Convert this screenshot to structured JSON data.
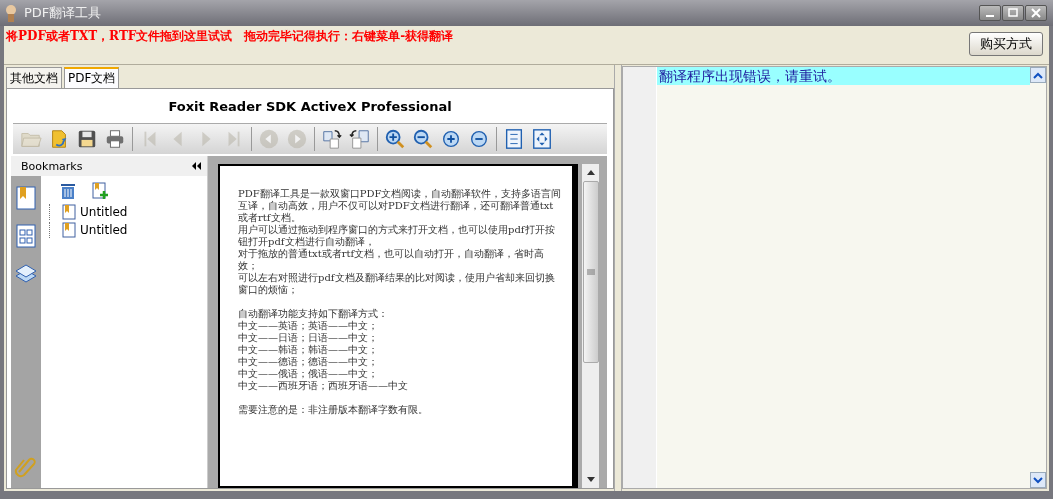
{
  "window": {
    "title": "PDF翻译工具"
  },
  "notice": "将PDF或者TXT，RTF文件拖到这里试试　拖动完毕记得执行：右键菜单-获得翻译",
  "buy_button": "购买方式",
  "tabs": [
    {
      "label": "其他文档",
      "selected": false
    },
    {
      "label": "PDF文档",
      "selected": true
    }
  ],
  "viewer": {
    "title": "Foxit Reader SDK ActiveX Professional",
    "toolbar": [
      [
        {
          "kind": "open-folder",
          "disabled": true
        },
        {
          "kind": "open-file",
          "disabled": false
        },
        {
          "kind": "save",
          "disabled": false
        },
        {
          "kind": "print",
          "disabled": false
        }
      ],
      [
        {
          "kind": "first",
          "disabled": true
        },
        {
          "kind": "prev",
          "disabled": true
        },
        {
          "kind": "next",
          "disabled": true
        },
        {
          "kind": "last",
          "disabled": true
        }
      ],
      [
        {
          "kind": "back",
          "disabled": true
        },
        {
          "kind": "forward",
          "disabled": true
        }
      ],
      [
        {
          "kind": "rotate-right",
          "disabled": false
        },
        {
          "kind": "rotate-left",
          "disabled": false
        }
      ],
      [
        {
          "kind": "zoom-in",
          "disabled": false
        },
        {
          "kind": "zoom-out",
          "disabled": false
        },
        {
          "kind": "plus",
          "disabled": false
        },
        {
          "kind": "minus",
          "disabled": false
        }
      ],
      [
        {
          "kind": "actual-size",
          "disabled": false
        },
        {
          "kind": "fit-page",
          "disabled": false
        }
      ]
    ],
    "bookmarks_header": "Bookmarks",
    "bookmarks": [
      "Untitled",
      "Untitled"
    ],
    "page_paragraphs": [
      [
        "PDF翻译工具是一款双窗口PDF文档阅读，自动翻译软件，支持多语言间互译，自动高效，用户不仅可以对PDF文档进行翻译，还可翻译普通txt或者rtf文档。",
        "用户可以通过拖动到程序窗口的方式来打开文档，也可以使用pdf打开按钮打开pdf文档进行自动翻译，",
        "对于拖放的普通txt或者rtf文档，也可以自动打开，自动翻译，省时高效；",
        "可以左右对照进行pdf文档及翻译结果的比对阅读，使用户省却来回切换窗口的烦恼；"
      ],
      [
        "自动翻译功能支持如下翻译方式：",
        "中文——英语；英语——中文；",
        "中文——日语；日语——中文；",
        "中文——韩语；韩语——中文；",
        "中文——德语；德语——中文；",
        "中文——俄语；俄语——中文；",
        "中文——西班牙语；西班牙语——中文"
      ],
      [
        "需要注意的是：非注册版本翻译字数有限。"
      ]
    ]
  },
  "translation": {
    "lines": [
      {
        "text": "翻译程序出现错误，请重试。",
        "selected": true
      }
    ]
  }
}
